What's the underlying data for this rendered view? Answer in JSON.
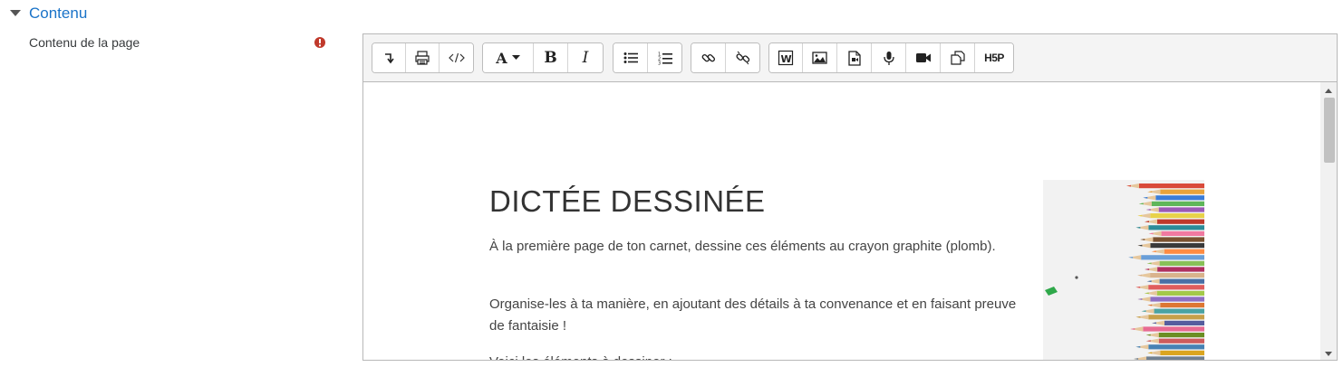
{
  "section": {
    "title": "Contenu"
  },
  "field": {
    "label": "Contenu de la page"
  },
  "toolbar": {
    "buttons": [
      "collapse-icon",
      "print-icon",
      "html-icon",
      "font-style-icon",
      "bold-icon",
      "italic-icon",
      "unordered-list-icon",
      "ordered-list-icon",
      "link-icon",
      "unlink-icon",
      "word-paste-icon",
      "image-icon",
      "media-icon",
      "record-audio-icon",
      "record-video-icon",
      "manage-files-icon"
    ],
    "bold_label": "B",
    "italic_label": "I",
    "font_label": "A",
    "h5p_label": "H5P"
  },
  "document": {
    "title": "DICTÉE DESSINÉE",
    "paragraphs": [
      "À la première page de ton carnet, dessine ces éléments au crayon graphite (plomb).",
      "Organise-les à ta manière, en ajoutant des détails à ta convenance et en faisant preuve de fantaisie !",
      "Voici les éléments à dessiner :"
    ]
  },
  "colors": {
    "accent": "#1a73c8",
    "required": "#c0392b"
  }
}
